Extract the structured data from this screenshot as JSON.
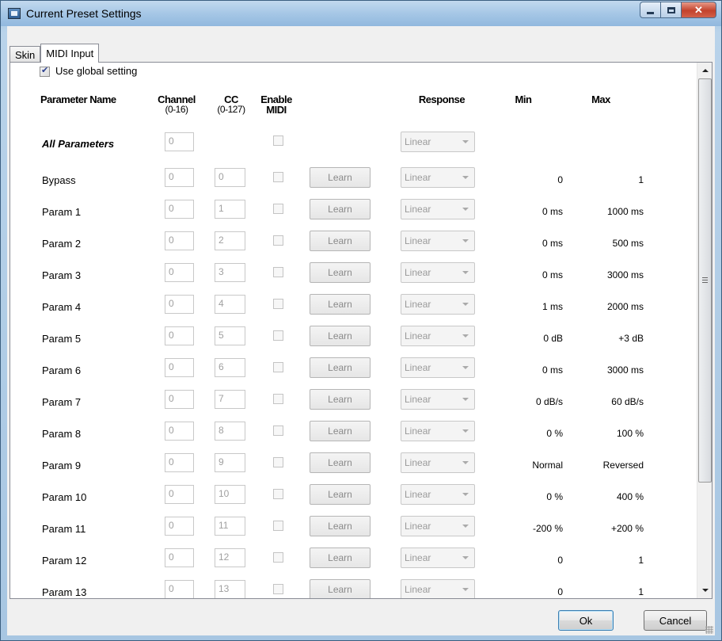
{
  "window": {
    "title": "Current Preset Settings",
    "caption": {
      "minimize": "",
      "maximize": "",
      "close": "✕"
    }
  },
  "tabs": [
    {
      "label": "Skin",
      "active": false
    },
    {
      "label": "MIDI Input",
      "active": true
    }
  ],
  "global_setting": {
    "label": "Use global setting",
    "checked": true
  },
  "headers": {
    "name": "Parameter Name",
    "channel": "Channel",
    "channel_range": "(0-16)",
    "cc": "CC",
    "cc_range": "(0-127)",
    "enable": "Enable",
    "enable2": "MIDI",
    "response": "Response",
    "min": "Min",
    "max": "Max"
  },
  "all_parameters": {
    "label": "All Parameters",
    "channel": "0",
    "response": "Linear"
  },
  "learn_label": "Learn",
  "rows": [
    {
      "name": "Bypass",
      "channel": "0",
      "cc": "0",
      "response": "Linear",
      "min": "0",
      "max": "1"
    },
    {
      "name": "Param 1",
      "channel": "0",
      "cc": "1",
      "response": "Linear",
      "min": "0 ms",
      "max": "1000 ms"
    },
    {
      "name": "Param 2",
      "channel": "0",
      "cc": "2",
      "response": "Linear",
      "min": "0 ms",
      "max": "500 ms"
    },
    {
      "name": "Param 3",
      "channel": "0",
      "cc": "3",
      "response": "Linear",
      "min": "0 ms",
      "max": "3000 ms"
    },
    {
      "name": "Param 4",
      "channel": "0",
      "cc": "4",
      "response": "Linear",
      "min": "1 ms",
      "max": "2000 ms"
    },
    {
      "name": "Param 5",
      "channel": "0",
      "cc": "5",
      "response": "Linear",
      "min": "0 dB",
      "max": "+3 dB"
    },
    {
      "name": "Param 6",
      "channel": "0",
      "cc": "6",
      "response": "Linear",
      "min": "0 ms",
      "max": "3000 ms"
    },
    {
      "name": "Param 7",
      "channel": "0",
      "cc": "7",
      "response": "Linear",
      "min": "0 dB/s",
      "max": "60 dB/s"
    },
    {
      "name": "Param 8",
      "channel": "0",
      "cc": "8",
      "response": "Linear",
      "min": "0 %",
      "max": "100 %"
    },
    {
      "name": "Param 9",
      "channel": "0",
      "cc": "9",
      "response": "Linear",
      "min": "Normal",
      "max": "Reversed"
    },
    {
      "name": "Param 10",
      "channel": "0",
      "cc": "10",
      "response": "Linear",
      "min": "0 %",
      "max": "400 %"
    },
    {
      "name": "Param 11",
      "channel": "0",
      "cc": "11",
      "response": "Linear",
      "min": "-200 %",
      "max": "+200 %"
    },
    {
      "name": "Param 12",
      "channel": "0",
      "cc": "12",
      "response": "Linear",
      "min": "0",
      "max": "1"
    },
    {
      "name": "Param 13",
      "channel": "0",
      "cc": "13",
      "response": "Linear",
      "min": "0",
      "max": "1"
    }
  ],
  "buttons": {
    "ok": "Ok",
    "cancel": "Cancel"
  }
}
